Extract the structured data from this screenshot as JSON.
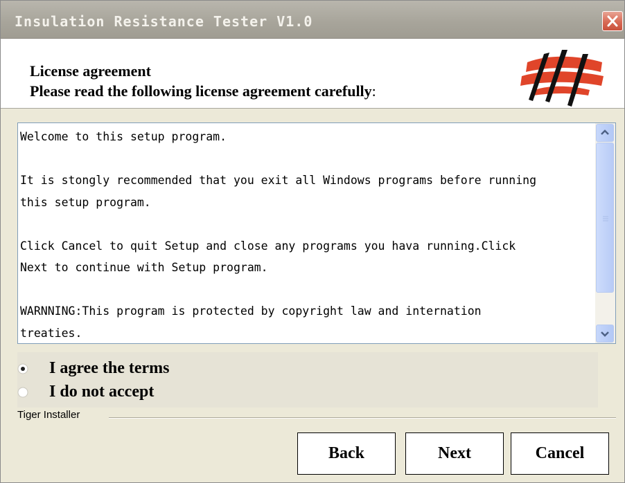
{
  "window": {
    "title": "Insulation Resistance Tester V1.0",
    "close_icon": "close-icon"
  },
  "header": {
    "title": "License agreement",
    "subtitle": "Please read the following license agreement carefully",
    "subtitle_suffix": ":",
    "logo_icon": "installer-logo-icon"
  },
  "license": {
    "lines": [
      "Welcome to this setup program.",
      "",
      "It is stongly recommended that you exit all Windows programs before running",
      "this setup program.",
      "",
      "Click Cancel to quit Setup and close any programs you hava running.Click",
      "Next to continue with Setup program.",
      "",
      "WARNNING:This program is protected by copyright law and internation",
      "treaties."
    ]
  },
  "options": {
    "agree_label": "I agree the terms",
    "decline_label": "I do not accept",
    "selected": "agree"
  },
  "footer": {
    "group_label": "Tiger Installer"
  },
  "buttons": {
    "back": "Back",
    "next": "Next",
    "cancel": "Cancel"
  },
  "colors": {
    "title_bar": "#a7a49a",
    "close_button": "#d86a55",
    "logo_accent": "#e0452a",
    "scrollbar": "#c6d7fb"
  }
}
